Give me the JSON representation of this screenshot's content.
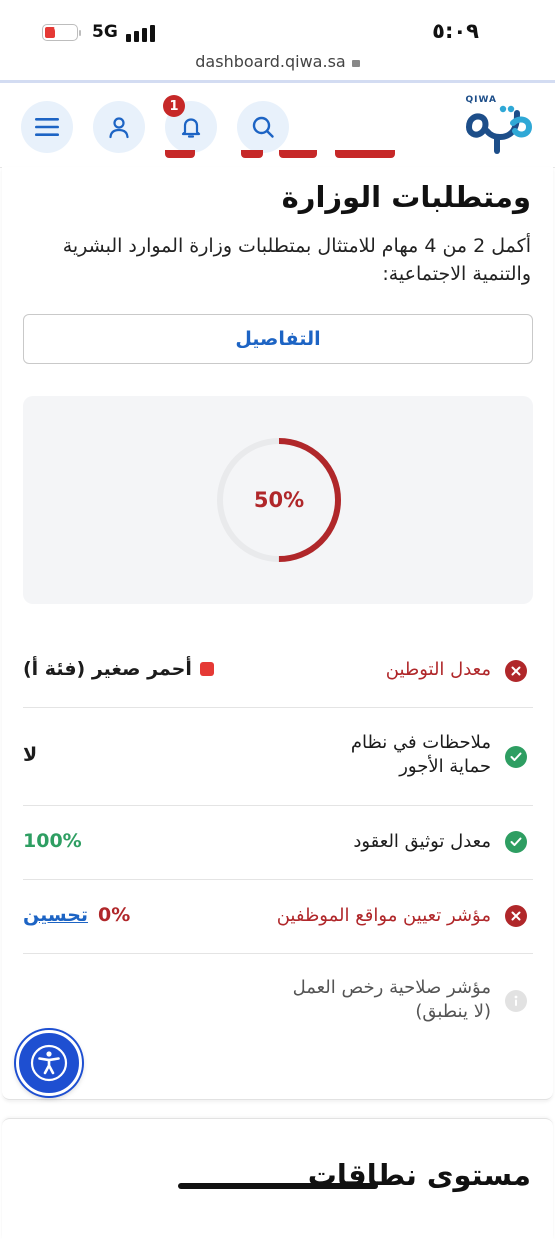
{
  "status_bar": {
    "battery": "٢٠",
    "network": "5G",
    "time": "٥:٠٩"
  },
  "browser": {
    "url": "dashboard.qiwa.sa"
  },
  "header": {
    "logo_latin": "QIWA",
    "logo_arabic": "قوى",
    "notification_count": "1"
  },
  "compliance_card": {
    "heading": "ومتطلبات الوزارة",
    "description": "أكمل 2 من 4 مهام للامتثال بمتطلبات وزارة الموارد البشرية والتنمية الاجتماعية:",
    "details_button": "التفاصيل",
    "progress_label": "50%",
    "progress_value": 0.5,
    "progress_color": "#b0272a",
    "rows": [
      {
        "label": "معدل التوطين",
        "status": "fail",
        "value": "أحمر صغير (فئة أ)"
      },
      {
        "label": "ملاحظات في نظام حماية الأجور",
        "status": "pass",
        "value": "لا"
      },
      {
        "label": "معدل توثيق العقود",
        "status": "pass",
        "value": "100%"
      },
      {
        "label": "مؤشر تعيين مواقع الموظفين",
        "status": "fail",
        "value": "0%",
        "link": "تحسين"
      },
      {
        "label": "مؤشر صلاحية رخص العمل (لا ينطبق)",
        "status": "na",
        "value": ""
      }
    ]
  },
  "nitaqat_card": {
    "title": "مستوى نطاقات"
  },
  "colors": {
    "accent_blue": "#1d64c4",
    "fail_red": "#b0272a",
    "pass_green": "#2e9e62"
  }
}
